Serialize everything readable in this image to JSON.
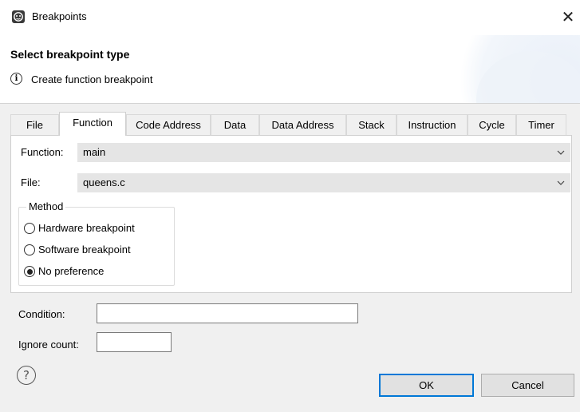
{
  "window": {
    "title": "Breakpoints",
    "close_glyph": "✕"
  },
  "header": {
    "title": "Select breakpoint type",
    "info_glyph": "i",
    "message": "Create function breakpoint"
  },
  "tabs": [
    {
      "label": "File",
      "active": false
    },
    {
      "label": "Function",
      "active": true
    },
    {
      "label": "Code Address",
      "active": false
    },
    {
      "label": "Data",
      "active": false
    },
    {
      "label": "Data Address",
      "active": false
    },
    {
      "label": "Stack",
      "active": false
    },
    {
      "label": "Instruction",
      "active": false
    },
    {
      "label": "Cycle",
      "active": false
    },
    {
      "label": "Timer",
      "active": false
    }
  ],
  "function_field": {
    "label": "Function:",
    "value": "main"
  },
  "file_field": {
    "label": "File:",
    "value": "queens.c"
  },
  "method": {
    "title": "Method",
    "options": [
      {
        "label": "Hardware breakpoint",
        "selected": false
      },
      {
        "label": "Software breakpoint",
        "selected": false
      },
      {
        "label": "No preference",
        "selected": true
      }
    ]
  },
  "condition": {
    "label": "Condition:",
    "value": ""
  },
  "ignore_count": {
    "label": "Ignore count:",
    "value": ""
  },
  "footer": {
    "help_glyph": "?",
    "ok_label": "OK",
    "cancel_label": "Cancel"
  },
  "colors": {
    "accent": "#0078d7",
    "window_bg": "#f0f0f0",
    "combo_bg": "#e5e5e5"
  },
  "icons": [
    "app-icon",
    "close-icon",
    "info-icon",
    "chevron-down-icon",
    "help-icon"
  ]
}
